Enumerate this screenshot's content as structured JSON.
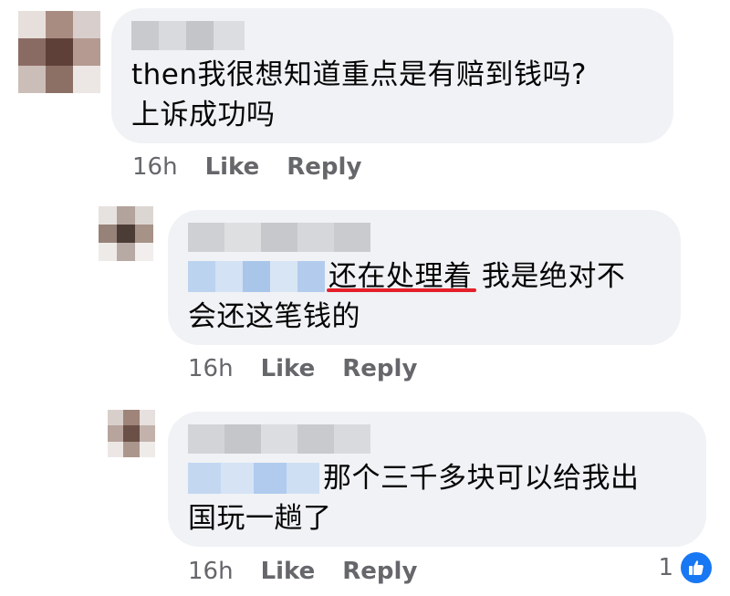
{
  "comments": [
    {
      "text_line1": "then我很想知道重点是有赔到钱吗?",
      "text_line2": "上诉成功吗",
      "time": "16h",
      "like": "Like",
      "reply": "Reply"
    },
    {
      "text_highlight": "还在处理着",
      "text_line1_rest": " 我是绝对不",
      "text_line2": "会还这笔钱的",
      "time": "16h",
      "like": "Like",
      "reply": "Reply"
    },
    {
      "text_line1": "那个三千多块可以给我出",
      "text_line2": "国玩一趟了",
      "time": "16h",
      "like": "Like",
      "reply": "Reply",
      "reaction_count": "1"
    }
  ],
  "colors": {
    "bubble": "#f0f2f5",
    "text": "#050505",
    "meta": "#65676b",
    "underline": "#e4202a",
    "like_icon": "#1877f2"
  },
  "icons": {
    "reaction": "thumbs-up-icon"
  }
}
